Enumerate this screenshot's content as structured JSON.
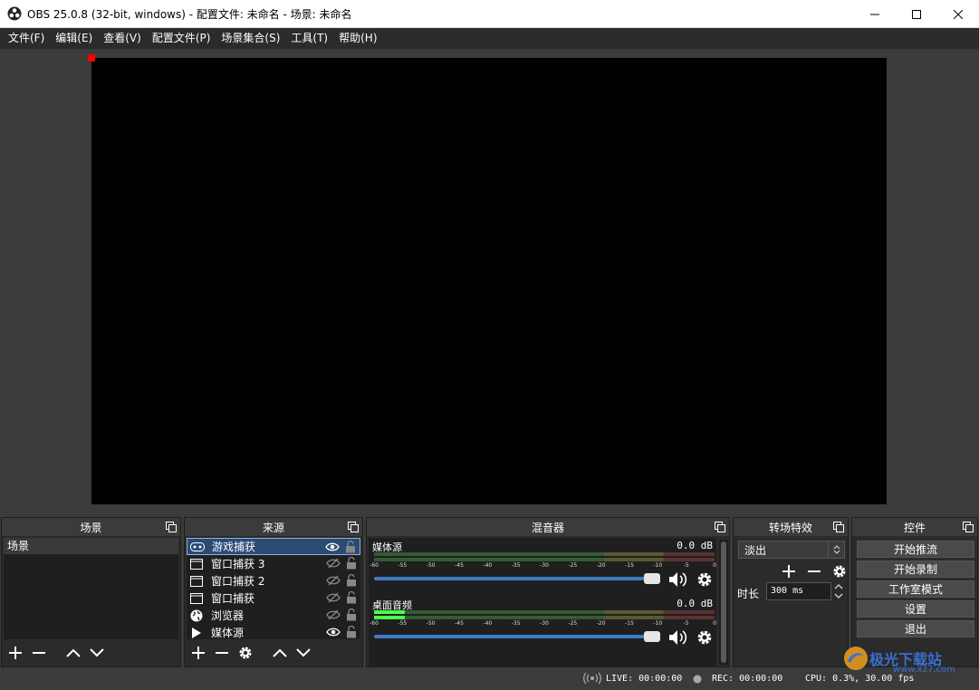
{
  "window": {
    "title": "OBS 25.0.8 (32-bit, windows) - 配置文件: 未命名 - 场景: 未命名"
  },
  "menu": [
    "文件(F)",
    "编辑(E)",
    "查看(V)",
    "配置文件(P)",
    "场景集合(S)",
    "工具(T)",
    "帮助(H)"
  ],
  "scenes": {
    "title": "场景",
    "items": [
      "场景"
    ]
  },
  "sources": {
    "title": "来源",
    "items": [
      {
        "name": "游戏捕获",
        "icon": "gamepad-icon",
        "visible": true,
        "selected": true
      },
      {
        "name": "窗口捕获 3",
        "icon": "window-icon",
        "visible": false
      },
      {
        "name": "窗口捕获 2",
        "icon": "window-icon",
        "visible": false
      },
      {
        "name": "窗口捕获",
        "icon": "window-icon",
        "visible": false
      },
      {
        "name": "浏览器",
        "icon": "globe-icon",
        "visible": false
      },
      {
        "name": "媒体源",
        "icon": "play-icon",
        "visible": true
      }
    ]
  },
  "mixer": {
    "title": "混音器",
    "ticks": [
      "-60",
      "-55",
      "-50",
      "-45",
      "-40",
      "-35",
      "-30",
      "-25",
      "-20",
      "-15",
      "-10",
      "-5",
      "0"
    ],
    "channels": [
      {
        "name": "媒体源",
        "db": "0.0 dB",
        "level": 0.0,
        "volume": 1.0
      },
      {
        "name": "桌面音频",
        "db": "0.0 dB",
        "level": 0.09,
        "volume": 1.0
      }
    ]
  },
  "transitions": {
    "title": "转场特效",
    "selected": "淡出",
    "duration_label": "时长",
    "duration_value": "300 ms"
  },
  "controls": {
    "title": "控件",
    "buttons": [
      "开始推流",
      "开始录制",
      "工作室模式",
      "设置",
      "退出"
    ]
  },
  "status": {
    "live": "LIVE: 00:00:00",
    "rec": "REC: 00:00:00",
    "cpu": "CPU: 0.3%, 30.00 fps"
  },
  "watermark": {
    "text": "极光下载站",
    "url": "www.xz7.com"
  },
  "colors": {
    "accent": "#3e7ac4",
    "selection": "#2d4a73",
    "dock_bg": "#2b2b2b"
  }
}
